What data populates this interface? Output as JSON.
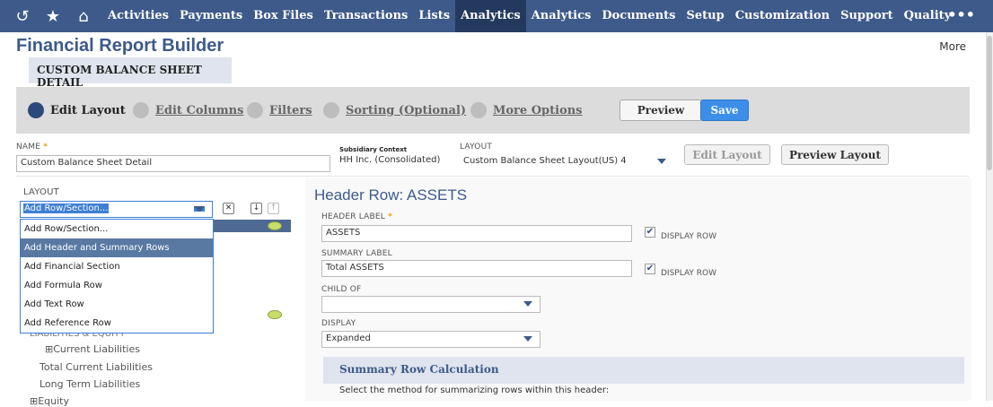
{
  "nav": {
    "icons": [
      "history-icon",
      "star-icon",
      "home-icon"
    ],
    "items": [
      "Activities",
      "Payments",
      "Box Files",
      "Transactions",
      "Lists",
      "Analytics",
      "Analytics",
      "Documents",
      "Setup",
      "Customization",
      "Support",
      "Quality"
    ],
    "active_index": 5,
    "more": "•••"
  },
  "page": {
    "title": "Financial Report Builder",
    "more": "More",
    "subtitle": "CUSTOM BALANCE SHEET DETAIL"
  },
  "steps": {
    "items": [
      "Edit Layout",
      "Edit Columns",
      "Filters",
      "Sorting (Optional)",
      "More Options"
    ],
    "active_index": 0,
    "preview": "Preview",
    "save": "Save"
  },
  "form": {
    "name_label": "NAME",
    "name_value": "Custom Balance Sheet Detail",
    "subsidiary_label": "Subsidiary Context",
    "subsidiary_value": "HH Inc. (Consolidated)",
    "layout_label": "LAYOUT",
    "layout_value": "Custom Balance Sheet Layout(US) 4",
    "edit_layout": "Edit Layout",
    "preview_layout": "Preview Layout"
  },
  "left": {
    "layout_label": "LAYOUT",
    "select_value": "Add Row/Section...",
    "dropdown": [
      "Add Row/Section...",
      "Add Header and Summary Rows",
      "Add Financial Section",
      "Add Formula Row",
      "Add Text Row",
      "Add Reference Row"
    ],
    "highlight_index": 1,
    "tree": [
      "LIABILITIES & EQUITY",
      "Current Liabilities",
      "Total Current Liabilities",
      "Long Term Liabilities",
      "Equity"
    ]
  },
  "right": {
    "heading": "Header Row: ASSETS",
    "header_label": "HEADER LABEL",
    "header_value": "ASSETS",
    "display_row": "DISPLAY ROW",
    "summary_label": "SUMMARY LABEL",
    "summary_value": "Total ASSETS",
    "child_of_label": "CHILD OF",
    "display_label": "DISPLAY",
    "display_value": "Expanded",
    "calc_title": "Summary Row Calculation",
    "calc_desc": "Select the method for summarizing rows within this header:"
  },
  "colors": {
    "nav_bg": "#3d5a8a",
    "nav_active": "#233a5e",
    "accent": "#3c8ee8",
    "highlight": "#5979a3"
  }
}
